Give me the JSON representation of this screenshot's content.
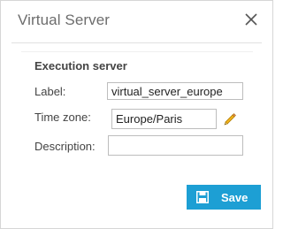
{
  "dialog": {
    "title": "Virtual Server"
  },
  "section": {
    "title": "Execution server"
  },
  "form": {
    "label_label": "Label:",
    "label_value": "virtual_server_europe",
    "timezone_label": "Time zone:",
    "timezone_value": "Europe/Paris",
    "description_label": "Description:",
    "description_value": ""
  },
  "actions": {
    "save_label": "Save"
  },
  "icons": {
    "close": "close-icon",
    "edit": "pencil-icon",
    "save": "floppy-disk-icon"
  },
  "colors": {
    "accent": "#1d9fd4"
  }
}
